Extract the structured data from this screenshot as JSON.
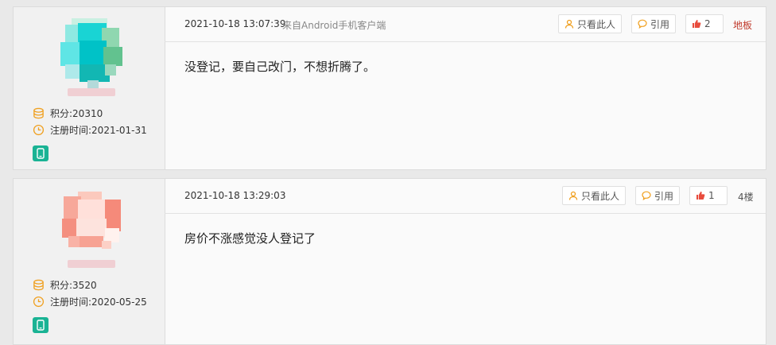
{
  "posts": [
    {
      "user": {
        "points_label": "积分:",
        "points": "20310",
        "reg_label": "注册时间:",
        "reg_date": "2021-01-31"
      },
      "time": "2021-10-18 13:07:39",
      "source": "来自Android手机客户端",
      "only_this_label": "只看此人",
      "quote_label": "引用",
      "likes": "2",
      "floor": "地板",
      "floor_color": "#c0392b",
      "content": "没登记，要自己改门，不想折腾了。"
    },
    {
      "user": {
        "points_label": "积分:",
        "points": "3520",
        "reg_label": "注册时间:",
        "reg_date": "2020-05-25"
      },
      "time": "2021-10-18 13:29:03",
      "source": "",
      "only_this_label": "只看此人",
      "quote_label": "引用",
      "likes": "1",
      "floor": "4楼",
      "floor_color": "#555555",
      "content": "房价不涨感觉没人登记了"
    }
  ],
  "colors": {
    "accent_orange": "#f0a020",
    "like_red": "#e84c3d",
    "mobile_green": "#1ab394"
  },
  "icons": [
    "coins-icon",
    "clock-icon",
    "mobile-icon",
    "user-icon",
    "quote-icon",
    "thumbs-up-icon"
  ]
}
